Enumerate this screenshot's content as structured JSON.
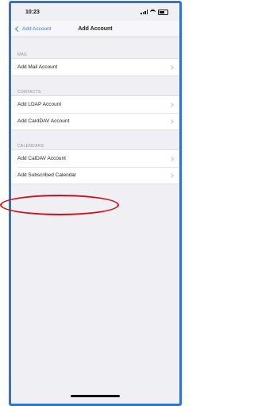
{
  "status_bar": {
    "time": "10:23"
  },
  "nav": {
    "back_label": "Add Account",
    "title": "Add Account"
  },
  "sections": [
    {
      "header": "MAIL",
      "items": [
        "Add Mail Account"
      ]
    },
    {
      "header": "CONTACTS",
      "items": [
        "Add LDAP Account",
        "Add CardDAV Account"
      ]
    },
    {
      "header": "CALENDARS",
      "items": [
        "Add CalDAV Account",
        "Add Subscribed Calendar"
      ]
    }
  ],
  "colors": {
    "accent": "#2f7bf6",
    "annotation": "#d0101a",
    "frame_border": "#2f76c8"
  }
}
